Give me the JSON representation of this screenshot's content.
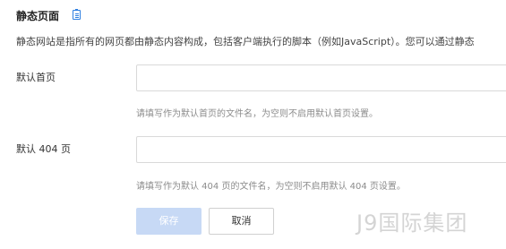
{
  "section": {
    "title": "静态页面",
    "title_icon": "document-icon",
    "description": "静态网站是指所有的网页都由静态内容构成，包括客户端执行的脚本（例如JavaScript）。您可以通过静态"
  },
  "fields": {
    "index": {
      "label": "默认首页",
      "value": "",
      "hint": "请填写作为默认首页的文件名，为空则不启用默认首页设置。"
    },
    "not_found": {
      "label": "默认 404 页",
      "value": "",
      "hint": "请填写作为默认 404 页的文件名，为空则不启用默认 404 页设置。"
    }
  },
  "actions": {
    "save_label": "保存",
    "cancel_label": "取消"
  },
  "watermark": {
    "text": "J9国际集团"
  },
  "colors": {
    "accent": "#2f7fe0",
    "save_disabled_bg": "#c7d9f5",
    "hint_text": "#8c8c8c",
    "input_border": "#d9d9d9"
  }
}
